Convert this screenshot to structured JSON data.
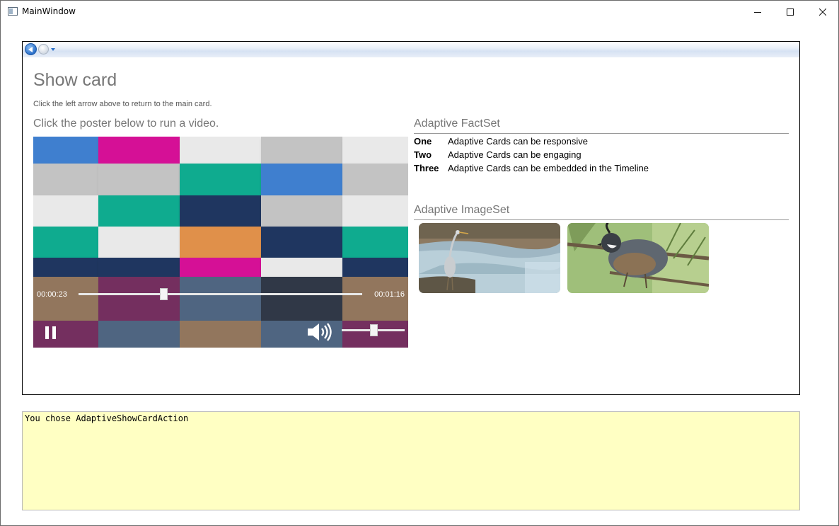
{
  "window": {
    "title": "MainWindow",
    "controls": [
      "minimize-icon",
      "maximize-icon",
      "close-icon"
    ]
  },
  "navigation": {
    "back_icon": "back-arrow-icon",
    "forward_icon": "forward-arrow-icon",
    "dropdown_icon": "chevron-down-icon"
  },
  "card": {
    "title": "Show card",
    "subtitle": "Click the left arrow above to return to the main card.",
    "poster_caption": "Click the poster below to run a video."
  },
  "media": {
    "elapsed": "00:00:23",
    "duration": "00:01:16",
    "progress_fraction": 0.3,
    "volume_fraction": 0.5,
    "play_state_icon": "pause-icon",
    "volume_icon": "speaker-icon",
    "tile_colors": {
      "blue": "#3f7fcf",
      "magenta": "#d51096",
      "teal": "#0fab8f",
      "navy": "#1f3660",
      "orange": "#e0904a",
      "light": "#e9e9e9",
      "gray": "#c3c3c3"
    }
  },
  "factset": {
    "heading": "Adaptive FactSet",
    "facts": [
      {
        "title": "One",
        "value": "Adaptive Cards can be responsive"
      },
      {
        "title": "Two",
        "value": "Adaptive Cards can be engaging"
      },
      {
        "title": "Three",
        "value": "Adaptive Cards can be embedded in the Timeline"
      }
    ]
  },
  "imageset": {
    "heading": "Adaptive ImageSet",
    "images": [
      "heron-image",
      "quail-image"
    ]
  },
  "output": {
    "text": "You chose AdaptiveShowCardAction",
    "background": "#ffffc3"
  }
}
